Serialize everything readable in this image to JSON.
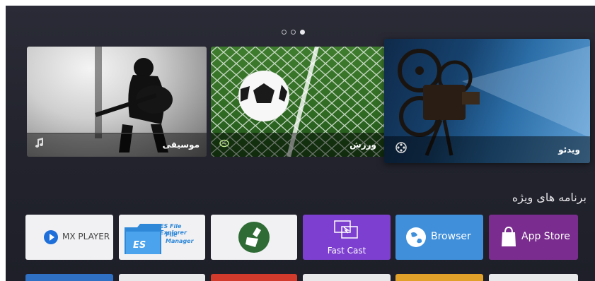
{
  "pager": {
    "pages": 3,
    "active_index": 2
  },
  "banners": {
    "music": {
      "label": "موسیقی",
      "icon": "music-note-icon"
    },
    "sport": {
      "label": "ورزش",
      "icon": "sport-ball-icon"
    },
    "video": {
      "label": "ویدئو",
      "icon": "film-reel-icon"
    }
  },
  "section": {
    "title": "برنامه های ویژه"
  },
  "apps": {
    "mx_player": {
      "label": "MX PLAYER",
      "color": "#1e6fd9"
    },
    "es_file": {
      "line1": "ES File Explorer",
      "line2": "File Manager",
      "mark": "ES",
      "color": "#2f88d8"
    },
    "cleaner": {
      "icon": "broom-icon",
      "color": "#2f6b35"
    },
    "fast_cast": {
      "label": "Fast Cast",
      "color": "#7d3fd0"
    },
    "browser": {
      "label": "Browser",
      "color": "#3f8fdb"
    },
    "app_store": {
      "label": "App Store",
      "color": "#7a2d8e"
    }
  },
  "colors": {
    "background": "#23242e",
    "bottom_row": [
      "#2f6fc4",
      "#e9e9ec",
      "#d23b2b",
      "#e9e9ec",
      "#e0a02a",
      "#e9e9ec"
    ]
  }
}
